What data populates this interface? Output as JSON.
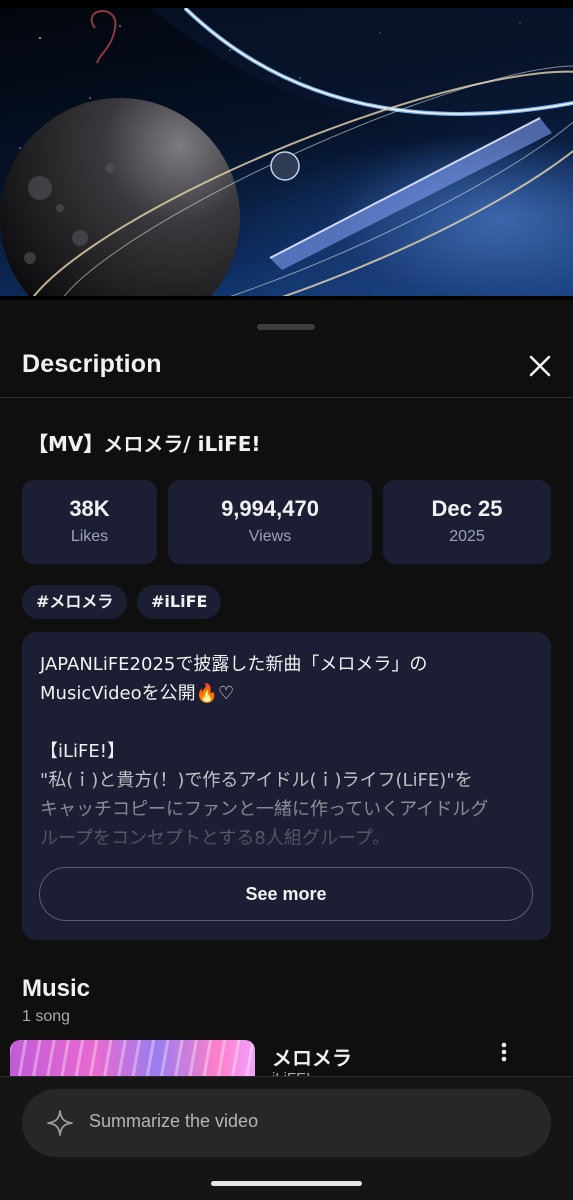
{
  "video": {
    "scene": "moon-space-station-artwork"
  },
  "description_panel": {
    "title": "Description",
    "close_icon": "close-icon"
  },
  "video_title": "【MV】メロメラ/ iLiFE!",
  "stats": [
    {
      "value": "38K",
      "label": "Likes"
    },
    {
      "value": "9,994,470",
      "label": "Views"
    },
    {
      "value": "Dec 25",
      "label": "2025"
    }
  ],
  "tags": [
    "#メロメラ",
    "#iLiFE"
  ],
  "description": {
    "text": "JAPANLiFE2025で披露した新曲「メロメラ」の\nMusicVideoを公開🔥♡\n\n【iLiFE!】\n\"私(ｉ)と貴方(！)で作るアイドル(ｉ)ライフ(LiFE)\"を\nキャッチコピーにファンと一緒に作っていくアイドルグ\nループをコンセプトとする8人組グループ。",
    "see_more_label": "See more"
  },
  "music": {
    "heading": "Music",
    "count_label": "1 song",
    "items": [
      {
        "title": "メロメラ",
        "artist": "iLiFE!"
      }
    ]
  },
  "summarize": {
    "label": "Summarize the video",
    "icon": "sparkle-icon"
  },
  "colors": {
    "background": "#0f0f0f",
    "card": "#1c1f33",
    "text": "#f1f1f1",
    "muted": "#9da3b8"
  }
}
